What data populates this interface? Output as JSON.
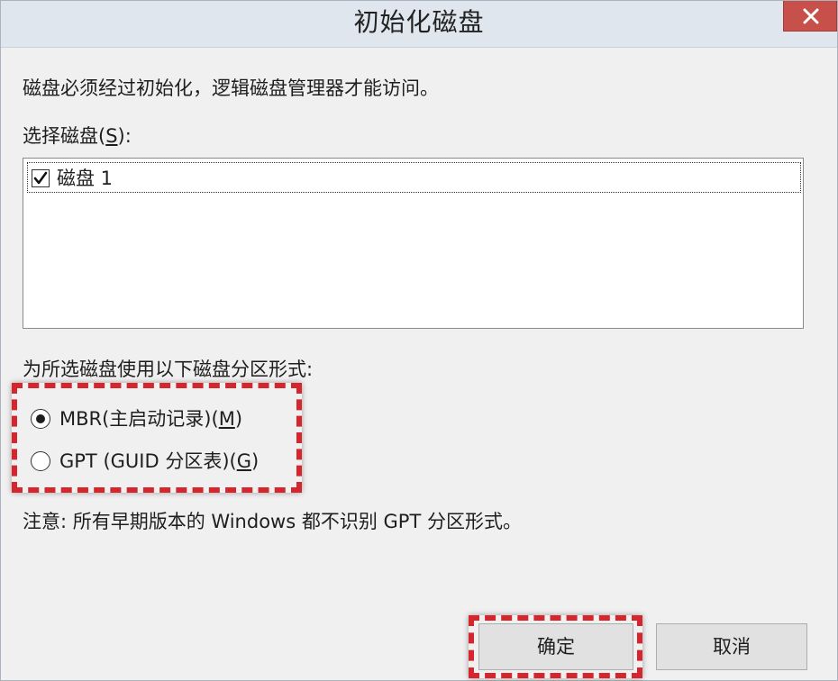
{
  "dialog": {
    "title": "初始化磁盘",
    "message": "磁盘必须经过初始化，逻辑磁盘管理器才能访问。",
    "select_label": "选择磁盘(",
    "select_mnemonic": "S",
    "select_suffix": "):",
    "disks": [
      {
        "label": "磁盘 1",
        "checked": true
      }
    ],
    "partition_label": "为所选磁盘使用以下磁盘分区形式:",
    "options": [
      {
        "label": "MBR(主启动记录)(",
        "mnemonic": "M",
        "suffix": ")",
        "selected": true
      },
      {
        "label": "GPT (GUID 分区表)(",
        "mnemonic": "G",
        "suffix": ")",
        "selected": false
      }
    ],
    "note": "注意: 所有早期版本的 Windows 都不识别 GPT 分区形式。",
    "ok_label": "确定",
    "cancel_label": "取消"
  },
  "colors": {
    "highlight": "#d4262c",
    "close_button": "#c7504a",
    "titlebar": "#dfe6ee",
    "body": "#f0f0f0"
  },
  "icons": {
    "close": "close-icon",
    "checkbox": "checkmark-icon"
  }
}
